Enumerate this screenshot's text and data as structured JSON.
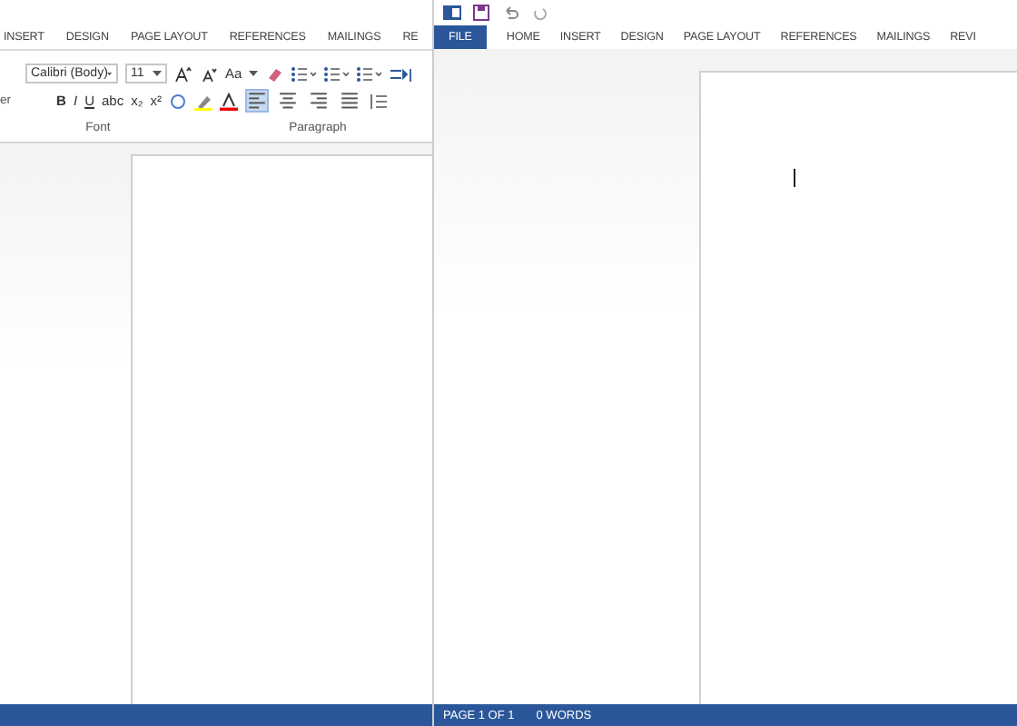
{
  "left_window": {
    "tabs": [
      {
        "label": "INSERT",
        "selected": false
      },
      {
        "label": "DESIGN",
        "selected": false
      },
      {
        "label": "PAGE LAYOUT",
        "selected": false
      },
      {
        "label": "REFERENCES",
        "selected": false
      },
      {
        "label": "MAILINGS",
        "selected": false
      },
      {
        "label": "RE",
        "selected": false
      }
    ],
    "ribbon": {
      "clipboard_fragment": "er",
      "font_name": "Calibri (Body)",
      "font_size": "11",
      "change_case": "Aa",
      "format_buttons": [
        "B",
        "I",
        "U",
        "abc",
        "x₂",
        "x²"
      ],
      "alignments": [
        {
          "kind": "left",
          "selected": true
        },
        {
          "kind": "center",
          "selected": false
        },
        {
          "kind": "right",
          "selected": false
        },
        {
          "kind": "justify",
          "selected": false
        }
      ],
      "groups": [
        "Font",
        "Paragraph"
      ]
    }
  },
  "right_window": {
    "tabs": [
      {
        "label": "FILE",
        "selected": true
      },
      {
        "label": "HOME",
        "selected": false
      },
      {
        "label": "INSERT",
        "selected": false
      },
      {
        "label": "DESIGN",
        "selected": false
      },
      {
        "label": "PAGE LAYOUT",
        "selected": false
      },
      {
        "label": "REFERENCES",
        "selected": false
      },
      {
        "label": "MAILINGS",
        "selected": false
      },
      {
        "label": "REVI",
        "selected": false
      }
    ],
    "status_bar": {
      "page": "PAGE 1 OF 1",
      "words": "0 WORDS"
    }
  }
}
